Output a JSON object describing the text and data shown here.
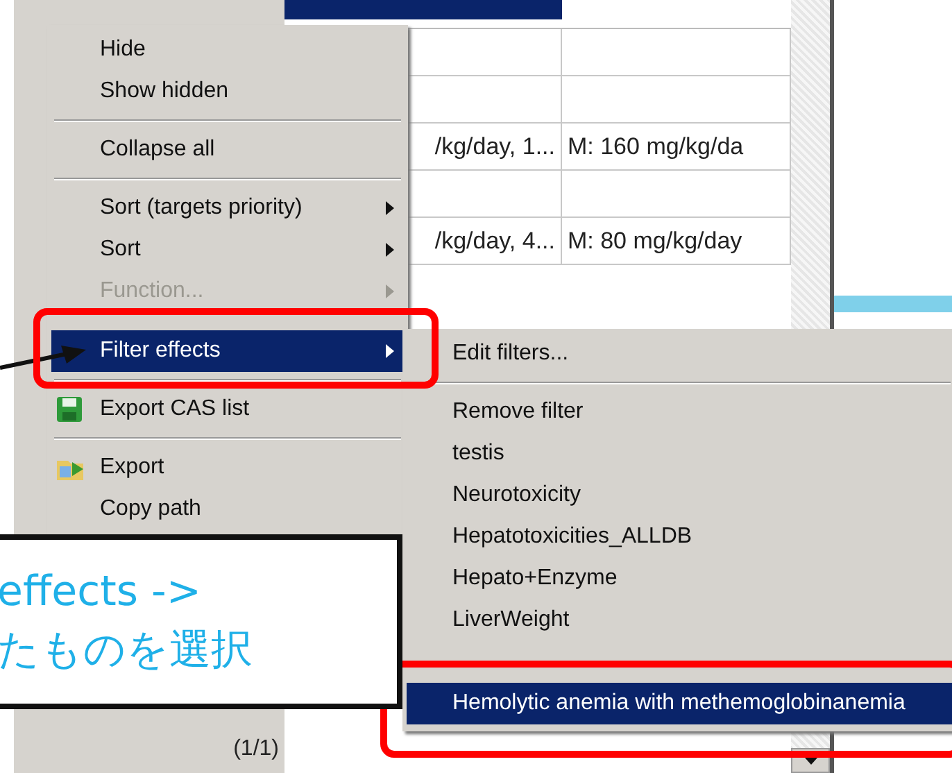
{
  "table": {
    "rows": [
      {
        "column_1": "",
        "column_2": ""
      },
      {
        "column_1": "",
        "column_2": ""
      },
      {
        "column_1": "/kg/day, 1...",
        "column_2": "M: 160 mg/kg/da"
      },
      {
        "column_1": "",
        "column_2": ""
      },
      {
        "column_1": "/kg/day, 4...",
        "column_2": "M: 80 mg/kg/day"
      }
    ]
  },
  "pager": "(1/1)",
  "context_menu": {
    "items": [
      {
        "kind": "item",
        "label": "Hide",
        "submenu": false,
        "disabled": false,
        "selected": false
      },
      {
        "kind": "item",
        "label": "Show hidden",
        "submenu": false,
        "disabled": false,
        "selected": false
      },
      {
        "kind": "separator"
      },
      {
        "kind": "item",
        "label": "Collapse all",
        "submenu": false,
        "disabled": false,
        "selected": false
      },
      {
        "kind": "separator"
      },
      {
        "kind": "item",
        "label": "Sort (targets priority)",
        "submenu": true,
        "disabled": false,
        "selected": false
      },
      {
        "kind": "item",
        "label": "Sort",
        "submenu": true,
        "disabled": false,
        "selected": false
      },
      {
        "kind": "item",
        "label": "Function...",
        "submenu": true,
        "disabled": true,
        "selected": false
      },
      {
        "kind": "item",
        "label": "Filter effects",
        "submenu": true,
        "disabled": false,
        "selected": true
      },
      {
        "kind": "separator"
      },
      {
        "kind": "save",
        "label": "Export CAS list",
        "submenu": false,
        "disabled": false,
        "selected": false
      },
      {
        "kind": "separator"
      },
      {
        "kind": "export",
        "label": "Export",
        "submenu": false,
        "disabled": false,
        "selected": false
      },
      {
        "kind": "item",
        "label": "Copy path",
        "submenu": false,
        "disabled": false,
        "selected": false
      }
    ]
  },
  "submenu": {
    "items": [
      {
        "kind": "item",
        "label": "Edit filters...",
        "selected": false
      },
      {
        "kind": "separator"
      },
      {
        "kind": "item",
        "label": "Remove filter",
        "selected": false
      },
      {
        "kind": "item",
        "label": "testis",
        "selected": false
      },
      {
        "kind": "item",
        "label": "Neurotoxicity",
        "selected": false
      },
      {
        "kind": "item",
        "label": "Hepatotoxicities_ALLDB",
        "selected": false
      },
      {
        "kind": "item",
        "label": "Hepato+Enzyme",
        "selected": false
      },
      {
        "kind": "item",
        "label": "LiverWeight",
        "selected": false
      },
      {
        "kind": "item",
        "label": "Hemolytic anemia with methemoglobinanemia",
        "selected": true
      }
    ]
  },
  "callout": {
    "lines": [
      "effects ->",
      "たものを選択"
    ]
  }
}
